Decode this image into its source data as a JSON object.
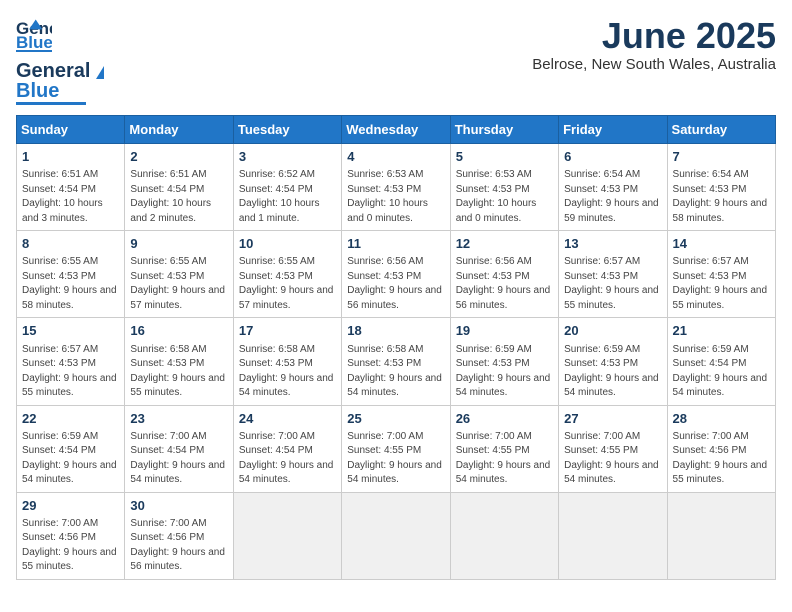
{
  "header": {
    "logo_general": "General",
    "logo_blue": "Blue",
    "month_year": "June 2025",
    "location": "Belrose, New South Wales, Australia"
  },
  "weekdays": [
    "Sunday",
    "Monday",
    "Tuesday",
    "Wednesday",
    "Thursday",
    "Friday",
    "Saturday"
  ],
  "weeks": [
    [
      {
        "day": "1",
        "sunrise": "Sunrise: 6:51 AM",
        "sunset": "Sunset: 4:54 PM",
        "daylight": "Daylight: 10 hours and 3 minutes."
      },
      {
        "day": "2",
        "sunrise": "Sunrise: 6:51 AM",
        "sunset": "Sunset: 4:54 PM",
        "daylight": "Daylight: 10 hours and 2 minutes."
      },
      {
        "day": "3",
        "sunrise": "Sunrise: 6:52 AM",
        "sunset": "Sunset: 4:54 PM",
        "daylight": "Daylight: 10 hours and 1 minute."
      },
      {
        "day": "4",
        "sunrise": "Sunrise: 6:53 AM",
        "sunset": "Sunset: 4:53 PM",
        "daylight": "Daylight: 10 hours and 0 minutes."
      },
      {
        "day": "5",
        "sunrise": "Sunrise: 6:53 AM",
        "sunset": "Sunset: 4:53 PM",
        "daylight": "Daylight: 10 hours and 0 minutes."
      },
      {
        "day": "6",
        "sunrise": "Sunrise: 6:54 AM",
        "sunset": "Sunset: 4:53 PM",
        "daylight": "Daylight: 9 hours and 59 minutes."
      },
      {
        "day": "7",
        "sunrise": "Sunrise: 6:54 AM",
        "sunset": "Sunset: 4:53 PM",
        "daylight": "Daylight: 9 hours and 58 minutes."
      }
    ],
    [
      {
        "day": "8",
        "sunrise": "Sunrise: 6:55 AM",
        "sunset": "Sunset: 4:53 PM",
        "daylight": "Daylight: 9 hours and 58 minutes."
      },
      {
        "day": "9",
        "sunrise": "Sunrise: 6:55 AM",
        "sunset": "Sunset: 4:53 PM",
        "daylight": "Daylight: 9 hours and 57 minutes."
      },
      {
        "day": "10",
        "sunrise": "Sunrise: 6:55 AM",
        "sunset": "Sunset: 4:53 PM",
        "daylight": "Daylight: 9 hours and 57 minutes."
      },
      {
        "day": "11",
        "sunrise": "Sunrise: 6:56 AM",
        "sunset": "Sunset: 4:53 PM",
        "daylight": "Daylight: 9 hours and 56 minutes."
      },
      {
        "day": "12",
        "sunrise": "Sunrise: 6:56 AM",
        "sunset": "Sunset: 4:53 PM",
        "daylight": "Daylight: 9 hours and 56 minutes."
      },
      {
        "day": "13",
        "sunrise": "Sunrise: 6:57 AM",
        "sunset": "Sunset: 4:53 PM",
        "daylight": "Daylight: 9 hours and 55 minutes."
      },
      {
        "day": "14",
        "sunrise": "Sunrise: 6:57 AM",
        "sunset": "Sunset: 4:53 PM",
        "daylight": "Daylight: 9 hours and 55 minutes."
      }
    ],
    [
      {
        "day": "15",
        "sunrise": "Sunrise: 6:57 AM",
        "sunset": "Sunset: 4:53 PM",
        "daylight": "Daylight: 9 hours and 55 minutes."
      },
      {
        "day": "16",
        "sunrise": "Sunrise: 6:58 AM",
        "sunset": "Sunset: 4:53 PM",
        "daylight": "Daylight: 9 hours and 55 minutes."
      },
      {
        "day": "17",
        "sunrise": "Sunrise: 6:58 AM",
        "sunset": "Sunset: 4:53 PM",
        "daylight": "Daylight: 9 hours and 54 minutes."
      },
      {
        "day": "18",
        "sunrise": "Sunrise: 6:58 AM",
        "sunset": "Sunset: 4:53 PM",
        "daylight": "Daylight: 9 hours and 54 minutes."
      },
      {
        "day": "19",
        "sunrise": "Sunrise: 6:59 AM",
        "sunset": "Sunset: 4:53 PM",
        "daylight": "Daylight: 9 hours and 54 minutes."
      },
      {
        "day": "20",
        "sunrise": "Sunrise: 6:59 AM",
        "sunset": "Sunset: 4:53 PM",
        "daylight": "Daylight: 9 hours and 54 minutes."
      },
      {
        "day": "21",
        "sunrise": "Sunrise: 6:59 AM",
        "sunset": "Sunset: 4:54 PM",
        "daylight": "Daylight: 9 hours and 54 minutes."
      }
    ],
    [
      {
        "day": "22",
        "sunrise": "Sunrise: 6:59 AM",
        "sunset": "Sunset: 4:54 PM",
        "daylight": "Daylight: 9 hours and 54 minutes."
      },
      {
        "day": "23",
        "sunrise": "Sunrise: 7:00 AM",
        "sunset": "Sunset: 4:54 PM",
        "daylight": "Daylight: 9 hours and 54 minutes."
      },
      {
        "day": "24",
        "sunrise": "Sunrise: 7:00 AM",
        "sunset": "Sunset: 4:54 PM",
        "daylight": "Daylight: 9 hours and 54 minutes."
      },
      {
        "day": "25",
        "sunrise": "Sunrise: 7:00 AM",
        "sunset": "Sunset: 4:55 PM",
        "daylight": "Daylight: 9 hours and 54 minutes."
      },
      {
        "day": "26",
        "sunrise": "Sunrise: 7:00 AM",
        "sunset": "Sunset: 4:55 PM",
        "daylight": "Daylight: 9 hours and 54 minutes."
      },
      {
        "day": "27",
        "sunrise": "Sunrise: 7:00 AM",
        "sunset": "Sunset: 4:55 PM",
        "daylight": "Daylight: 9 hours and 54 minutes."
      },
      {
        "day": "28",
        "sunrise": "Sunrise: 7:00 AM",
        "sunset": "Sunset: 4:56 PM",
        "daylight": "Daylight: 9 hours and 55 minutes."
      }
    ],
    [
      {
        "day": "29",
        "sunrise": "Sunrise: 7:00 AM",
        "sunset": "Sunset: 4:56 PM",
        "daylight": "Daylight: 9 hours and 55 minutes."
      },
      {
        "day": "30",
        "sunrise": "Sunrise: 7:00 AM",
        "sunset": "Sunset: 4:56 PM",
        "daylight": "Daylight: 9 hours and 56 minutes."
      },
      null,
      null,
      null,
      null,
      null
    ]
  ]
}
